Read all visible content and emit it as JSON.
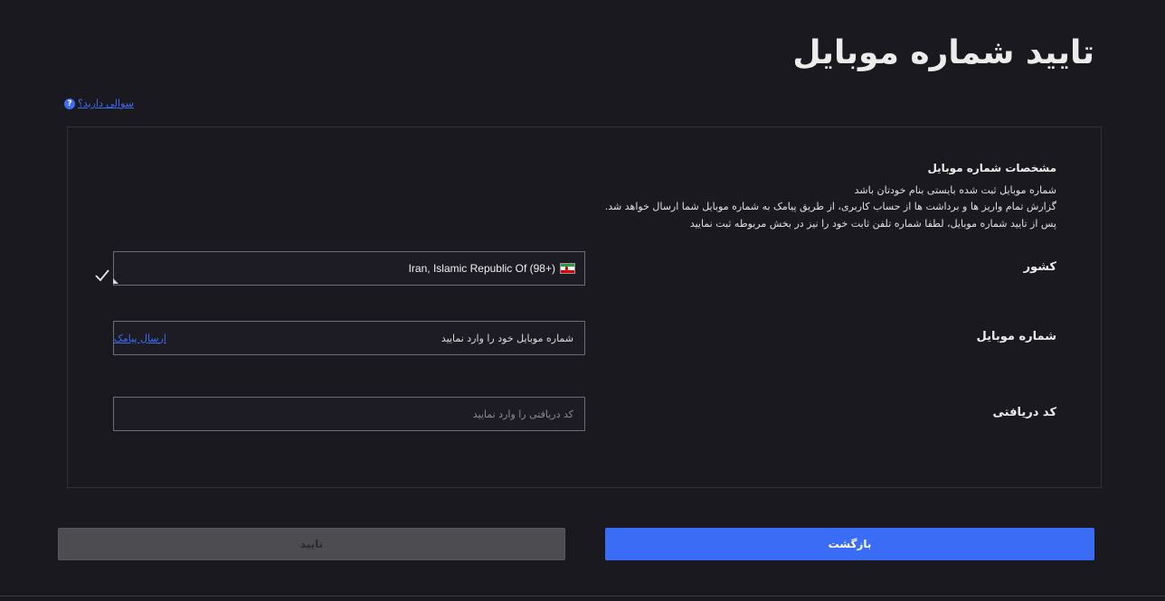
{
  "page": {
    "title": "تایید شماره موبایل"
  },
  "help": {
    "icon_glyph": "?",
    "label": "سوالی دارید؟"
  },
  "info": {
    "title": "مشخصات شماره موبایل",
    "lines": [
      "شماره موبایل ثبت شده بایستی بنام خودتان باشد",
      "گزارش تمام واریز ها و برداشت ها از حساب کاربری، از طریق پیامک به شماره موبایل شما ارسال خواهد شد.",
      "پس از تایید شماره موبایل، لطفا شماره تلفن ثابت خود را نیز در بخش مربوطه ثبت نمایید"
    ]
  },
  "form": {
    "country": {
      "label": "کشور",
      "value": "Iran, Islamic Republic Of (98+)",
      "flag_icon": "iran-flag-icon"
    },
    "mobile": {
      "label": "شماره موبایل",
      "placeholder": "شماره موبایل خود را وارد نمایید",
      "send_sms_label": "ارسال پیامک"
    },
    "code": {
      "label": "کد دریافتی",
      "placeholder": "کد دریافتی را وارد نمایید"
    }
  },
  "buttons": {
    "confirm_label": "تایید",
    "back_label": "بازگشت"
  },
  "colors": {
    "background": "#1a191f",
    "accent": "#3a6cf5",
    "link": "#3f6cf5",
    "disabled": "#4d4c51"
  }
}
